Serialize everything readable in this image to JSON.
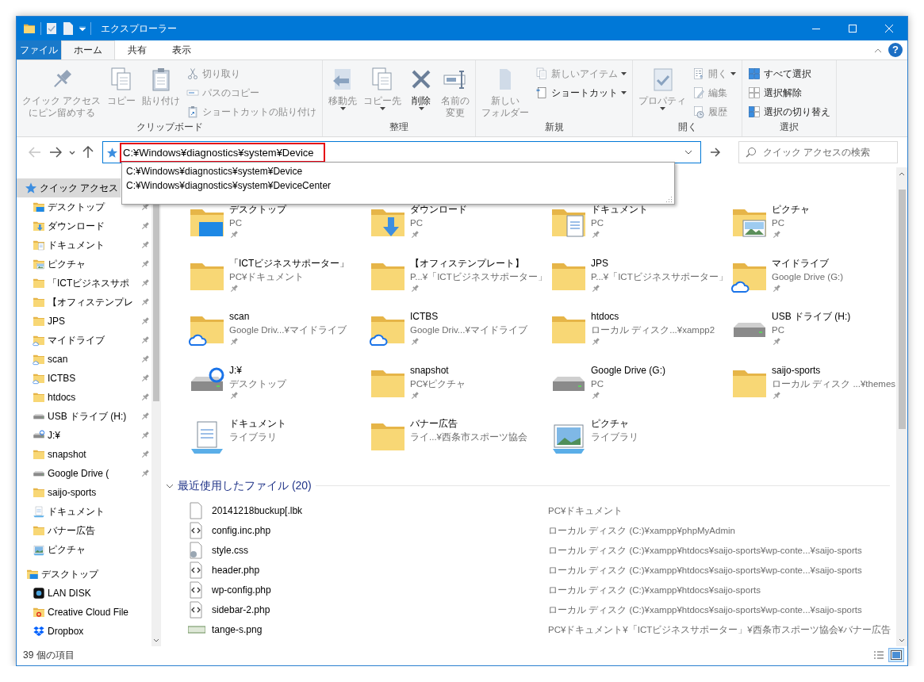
{
  "window": {
    "title": "エクスプローラー"
  },
  "ribbon_tabs": [
    {
      "label": "ファイル",
      "kind": "file",
      "selected": false
    },
    {
      "label": "ホーム",
      "kind": "tab",
      "selected": true
    },
    {
      "label": "共有",
      "kind": "tab",
      "selected": false
    },
    {
      "label": "表示",
      "kind": "tab",
      "selected": false
    }
  ],
  "help": {
    "label": "?"
  },
  "ribbon_groups": [
    {
      "label": "クリップボード",
      "commands": [
        {
          "lines": [
            "クイック アクセス",
            "にピン留めする"
          ],
          "kind": "large",
          "disabled": true,
          "menu": false
        },
        {
          "label": "コピー",
          "kind": "large",
          "disabled": true,
          "menu": false
        },
        {
          "label": "貼り付け",
          "kind": "large",
          "disabled": true,
          "menu": false
        },
        {
          "label": "切り取り",
          "kind": "small",
          "disabled": true,
          "menu": false
        },
        {
          "label": "パスのコピー",
          "kind": "small",
          "disabled": true,
          "menu": false
        },
        {
          "label": "ショートカットの貼り付け",
          "kind": "small",
          "disabled": true,
          "menu": false
        }
      ]
    },
    {
      "label": "整理",
      "commands": [
        {
          "label": "移動先",
          "kind": "large",
          "disabled": true,
          "menu": true
        },
        {
          "label": "コピー先",
          "kind": "large",
          "disabled": true,
          "menu": true
        },
        {
          "label": "削除",
          "kind": "large",
          "disabled": false,
          "menu": true
        },
        {
          "lines": [
            "名前の",
            "変更"
          ],
          "kind": "large",
          "disabled": true,
          "menu": false
        }
      ]
    },
    {
      "label": "新規",
      "commands": [
        {
          "lines": [
            "新しい",
            "フォルダー"
          ],
          "kind": "large",
          "disabled": true,
          "menu": false
        },
        {
          "label": "新しいアイテム",
          "kind": "small",
          "disabled": true,
          "menu": true
        },
        {
          "label": "ショートカット",
          "kind": "small",
          "disabled": false,
          "menu": true
        }
      ]
    },
    {
      "label": "開く",
      "commands": [
        {
          "label": "プロパティ",
          "kind": "large",
          "disabled": true,
          "menu": true
        },
        {
          "label": "開く",
          "kind": "small",
          "disabled": true,
          "menu": true
        },
        {
          "label": "編集",
          "kind": "small",
          "disabled": true,
          "menu": false
        },
        {
          "label": "履歴",
          "kind": "small",
          "disabled": true,
          "menu": false
        }
      ]
    },
    {
      "label": "選択",
      "commands": [
        {
          "label": "すべて選択",
          "kind": "small",
          "disabled": false,
          "menu": false
        },
        {
          "label": "選択解除",
          "kind": "small",
          "disabled": false,
          "menu": false
        },
        {
          "label": "選択の切り替え",
          "kind": "small",
          "disabled": false,
          "menu": false
        }
      ]
    }
  ],
  "navigation_buttons": [
    {
      "kind": "back",
      "disabled": true
    },
    {
      "kind": "forward",
      "disabled": false
    },
    {
      "kind": "recent",
      "disabled": false
    },
    {
      "kind": "up",
      "disabled": false
    }
  ],
  "address_bar": {
    "path": "C:¥Windows¥diagnostics¥system¥Device",
    "highlighted": true
  },
  "autocomplete": [
    "C:¥Windows¥diagnostics¥system¥Device",
    "C:¥Windows¥diagnostics¥system¥DeviceCenter"
  ],
  "search": {
    "placeholder": "クイック アクセスの検索"
  },
  "navigation": [
    {
      "label": "クイック アクセス",
      "kind": "star",
      "selected": true,
      "children": [
        {
          "label": "デスクトップ",
          "kind": "desktop",
          "pinned": true,
          "selected": false
        },
        {
          "label": "ダウンロード",
          "kind": "download",
          "pinned": true,
          "selected": false
        },
        {
          "label": "ドキュメント",
          "kind": "document",
          "pinned": true,
          "selected": false
        },
        {
          "label": "ピクチャ",
          "kind": "picture",
          "pinned": true,
          "selected": false
        },
        {
          "label": "「ICTビジネスサポ",
          "kind": "folder",
          "pinned": true,
          "selected": false
        },
        {
          "label": "【オフィステンプレ",
          "kind": "folder",
          "pinned": true,
          "selected": false
        },
        {
          "label": "JPS",
          "kind": "folder",
          "pinned": true,
          "selected": false
        },
        {
          "label": "マイドライブ",
          "kind": "cloud",
          "pinned": true,
          "selected": false
        },
        {
          "label": "scan",
          "kind": "cloud",
          "pinned": true,
          "selected": false
        },
        {
          "label": "ICTBS",
          "kind": "cloud",
          "pinned": true,
          "selected": false
        },
        {
          "label": "htdocs",
          "kind": "folder",
          "pinned": true,
          "selected": false
        },
        {
          "label": "USB ドライブ (H:)",
          "kind": "drive",
          "pinned": true,
          "selected": false
        },
        {
          "label": "J:¥",
          "kind": "unknown-drive",
          "pinned": true,
          "selected": false
        },
        {
          "label": "snapshot",
          "kind": "folder",
          "pinned": true,
          "selected": false
        },
        {
          "label": "Google Drive (",
          "kind": "drive",
          "pinned": true,
          "selected": false
        },
        {
          "label": "saijo-sports",
          "kind": "folder",
          "pinned": false,
          "selected": false
        },
        {
          "label": "ドキュメント",
          "kind": "document-library",
          "pinned": false,
          "selected": false
        },
        {
          "label": "バナー広告",
          "kind": "folder",
          "pinned": false,
          "selected": false
        },
        {
          "label": "ピクチャ",
          "kind": "picture-library",
          "pinned": false,
          "selected": false
        }
      ]
    },
    {
      "label": "デスクトップ",
      "kind": "desktop",
      "selected": false,
      "children": [
        {
          "label": "LAN DISK",
          "kind": "app",
          "selected": false
        },
        {
          "label": "Creative Cloud File",
          "kind": "creative-folder",
          "selected": false
        },
        {
          "label": "Dropbox",
          "kind": "dropbox",
          "selected": false
        }
      ]
    }
  ],
  "frequent_folders": [
    {
      "name": "デスクトップ",
      "location": "PC",
      "pinned": true,
      "kind": "desktop"
    },
    {
      "name": "ダウンロード",
      "location": "PC",
      "pinned": true,
      "kind": "download"
    },
    {
      "name": "ドキュメント",
      "location": "PC",
      "pinned": true,
      "kind": "document"
    },
    {
      "name": "ピクチャ",
      "location": "PC",
      "pinned": true,
      "kind": "picture"
    },
    {
      "name": "「ICTビジネスサポーター」",
      "location": "PC¥ドキュメント",
      "pinned": true,
      "kind": "folder"
    },
    {
      "name": "【オフィステンプレート】",
      "location": "P...¥「ICTビジネスサポーター」",
      "pinned": true,
      "kind": "folder"
    },
    {
      "name": "JPS",
      "location": "P...¥「ICTビジネスサポーター」",
      "pinned": true,
      "kind": "folder"
    },
    {
      "name": "マイドライブ",
      "location": "Google Drive (G:)",
      "pinned": true,
      "kind": "cloud"
    },
    {
      "name": "scan",
      "location": "Google Driv...¥マイドライブ",
      "pinned": true,
      "kind": "cloud"
    },
    {
      "name": "ICTBS",
      "location": "Google Driv...¥マイドライブ",
      "pinned": true,
      "kind": "cloud"
    },
    {
      "name": "htdocs",
      "location": "ローカル ディスク...¥xampp2",
      "pinned": true,
      "kind": "folder"
    },
    {
      "name": "USB ドライブ (H:)",
      "location": "PC",
      "pinned": true,
      "kind": "drive"
    },
    {
      "name": "J:¥",
      "location": "デスクトップ",
      "pinned": true,
      "kind": "unknown-drive"
    },
    {
      "name": "snapshot",
      "location": "PC¥ピクチャ",
      "pinned": true,
      "kind": "folder"
    },
    {
      "name": "Google Drive (G:)",
      "location": "PC",
      "pinned": true,
      "kind": "drive"
    },
    {
      "name": "saijo-sports",
      "location": "ローカル ディスク ...¥themes",
      "pinned": true,
      "kind": "folder"
    },
    {
      "name": "ドキュメント",
      "location": "ライブラリ",
      "pinned": false,
      "kind": "document-library"
    },
    {
      "name": "バナー広告",
      "location": "ライ...¥西条市スポーツ協会",
      "pinned": false,
      "kind": "folder"
    },
    {
      "name": "ピクチャ",
      "location": "ライブラリ",
      "pinned": false,
      "kind": "picture-library"
    }
  ],
  "recent_files": {
    "title": "最近使用したファイル (20)",
    "expanded": true,
    "rows": [
      {
        "name": "20141218buckup[.lbk",
        "location": "PC¥ドキュメント",
        "kind": "blank"
      },
      {
        "name": "config.inc.php",
        "location": "ローカル ディスク (C:)¥xampp¥phpMyAdmin",
        "kind": "code"
      },
      {
        "name": "style.css",
        "location": "ローカル ディスク (C:)¥xampp¥htdocs¥saijo-sports¥wp-conte...¥saijo-sports",
        "kind": "settings"
      },
      {
        "name": "header.php",
        "location": "ローカル ディスク (C:)¥xampp¥htdocs¥saijo-sports¥wp-conte...¥saijo-sports",
        "kind": "code"
      },
      {
        "name": "wp-config.php",
        "location": "ローカル ディスク (C:)¥xampp¥htdocs¥saijo-sports",
        "kind": "code"
      },
      {
        "name": "sidebar-2.php",
        "location": "ローカル ディスク (C:)¥xampp¥htdocs¥saijo-sports¥wp-conte...¥saijo-sports",
        "kind": "code"
      },
      {
        "name": "tange-s.png",
        "location": "PC¥ドキュメント¥「ICTビジネスサポーター」¥西条市スポーツ協会¥バナー広告",
        "kind": "image"
      }
    ]
  },
  "status_bar": {
    "text": "39 個の項目",
    "views": [
      {
        "kind": "details",
        "selected": false
      },
      {
        "kind": "tiles",
        "selected": true
      }
    ]
  }
}
